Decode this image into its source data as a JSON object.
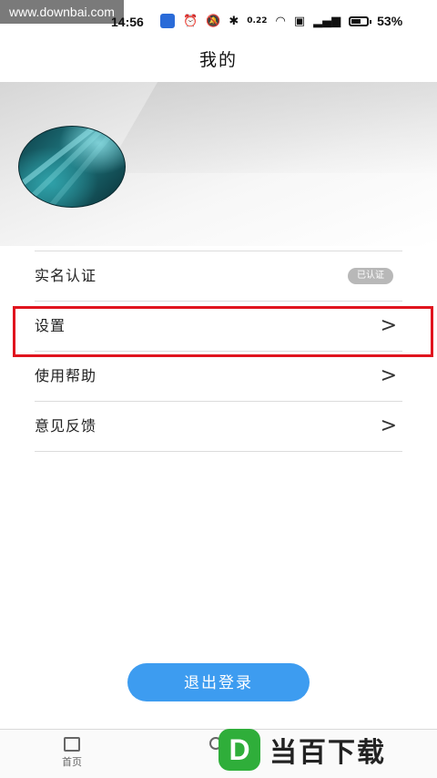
{
  "watermark": {
    "url": "www.downbai.com",
    "logo_letter": "D",
    "logo_text": "当百下载"
  },
  "status_bar": {
    "time": "14:56",
    "network_speed": "0.22",
    "battery": "53%"
  },
  "header": {
    "title": "我的"
  },
  "menu": {
    "items": [
      {
        "label": "实名认证",
        "badge": "已认证"
      },
      {
        "label": "设置",
        "chevron": ">"
      },
      {
        "label": "使用帮助",
        "chevron": ">"
      },
      {
        "label": "意见反馈",
        "chevron": ">"
      }
    ]
  },
  "logout": {
    "label": "退出登录"
  },
  "bottom_nav": {
    "home_label": "首页"
  },
  "colors": {
    "highlight": "#e0141e",
    "button": "#3d9cf0",
    "logo": "#2fae3a"
  }
}
